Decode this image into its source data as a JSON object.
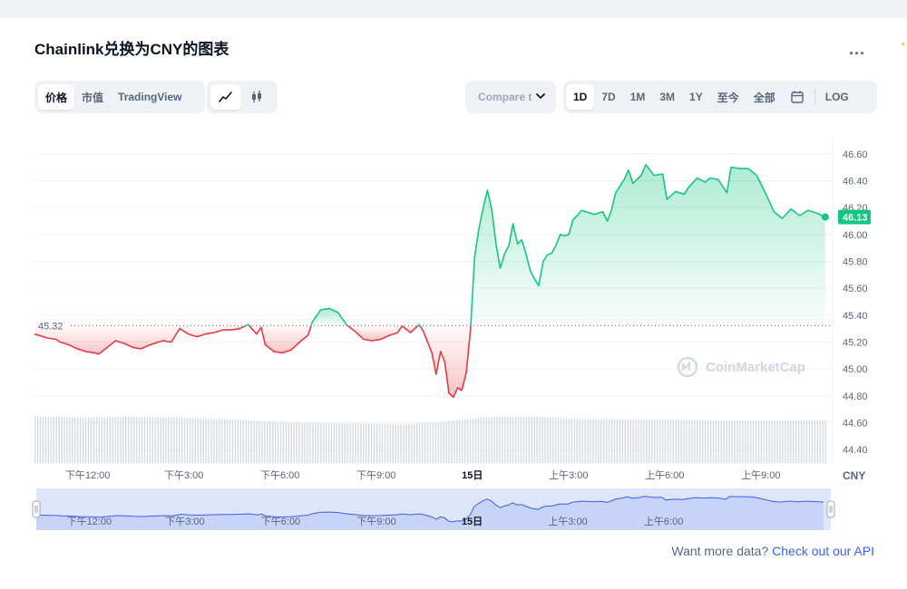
{
  "header": {
    "title": "Chainlink兑换为CNY的图表",
    "more_label": "..."
  },
  "tabs": {
    "price": "价格",
    "market_cap": "市值",
    "tradingview": "TradingView"
  },
  "chart_types": {
    "line_icon": "line-chart-icon",
    "candle_icon": "candlestick-icon"
  },
  "compare": {
    "label": "Compare t"
  },
  "ranges": {
    "d1": "1D",
    "d7": "7D",
    "m1": "1M",
    "m3": "3M",
    "y1": "1Y",
    "ytd": "至今",
    "all": "全部",
    "calendar_icon": "calendar-icon",
    "log": "LOG"
  },
  "colors": {
    "up": "#16c784",
    "down": "#ea3943",
    "accent": "#3861fb",
    "navigator": "#dfe6fb"
  },
  "watermark": "CoinMarketCap",
  "currency": "CNY",
  "footer": {
    "text": "Want more data?",
    "link": "Check out our API"
  },
  "chart_data": {
    "type": "line",
    "baseline": 45.32,
    "baseline_label": "45.32",
    "current_value": 46.13,
    "current_label": "46.13",
    "ylim": [
      44.3,
      46.72
    ],
    "yticks": [
      46.6,
      46.4,
      46.2,
      46.0,
      45.8,
      45.6,
      45.4,
      45.2,
      45.0,
      44.8,
      44.6,
      44.4
    ],
    "ytick_labels": [
      "46.60",
      "46.40",
      "46.20",
      "46.00",
      "45.80",
      "45.60",
      "45.40",
      "45.20",
      "45.00",
      "44.80",
      "44.60",
      "44.40"
    ],
    "xlim": [
      0,
      24.9
    ],
    "xticks": [
      {
        "label": "下午12:00",
        "t": 1.66
      },
      {
        "label": "下午3:00",
        "t": 4.66
      },
      {
        "label": "下午6:00",
        "t": 7.66
      },
      {
        "label": "下午9:00",
        "t": 10.66
      },
      {
        "label": "15日",
        "t": 13.66
      },
      {
        "label": "上午3:00",
        "t": 16.66
      },
      {
        "label": "上午6:00",
        "t": 19.66
      },
      {
        "label": "上午9:00",
        "t": 22.66
      }
    ],
    "navigator_ticks": [
      "下午12:00",
      "下午3:00",
      "下午6:00",
      "下午9:00",
      "15日",
      "上午3:00",
      "上午6:00"
    ],
    "series": [
      {
        "values": [
          [
            0.0,
            45.26
          ],
          [
            0.4,
            45.23
          ],
          [
            0.67,
            45.22
          ],
          [
            0.8,
            45.2
          ],
          [
            1.07,
            45.18
          ],
          [
            1.33,
            45.15
          ],
          [
            1.6,
            45.13
          ],
          [
            1.87,
            45.12
          ],
          [
            2.0,
            45.11
          ],
          [
            2.27,
            45.16
          ],
          [
            2.53,
            45.21
          ],
          [
            2.8,
            45.19
          ],
          [
            3.07,
            45.16
          ],
          [
            3.33,
            45.15
          ],
          [
            3.6,
            45.18
          ],
          [
            3.87,
            45.2
          ],
          [
            4.0,
            45.21
          ],
          [
            4.27,
            45.2
          ],
          [
            4.53,
            45.3
          ],
          [
            4.8,
            45.26
          ],
          [
            5.07,
            45.24
          ],
          [
            5.33,
            45.26
          ],
          [
            5.6,
            45.27
          ],
          [
            5.87,
            45.29
          ],
          [
            6.13,
            45.29
          ],
          [
            6.4,
            45.3
          ],
          [
            6.67,
            45.33
          ],
          [
            6.93,
            45.26
          ],
          [
            7.07,
            45.31
          ],
          [
            7.2,
            45.18
          ],
          [
            7.47,
            45.13
          ],
          [
            7.73,
            45.12
          ],
          [
            8.0,
            45.14
          ],
          [
            8.27,
            45.2
          ],
          [
            8.53,
            45.25
          ],
          [
            8.67,
            45.35
          ],
          [
            8.93,
            45.44
          ],
          [
            9.2,
            45.45
          ],
          [
            9.47,
            45.42
          ],
          [
            9.73,
            45.33
          ],
          [
            10.0,
            45.28
          ],
          [
            10.27,
            45.22
          ],
          [
            10.53,
            45.21
          ],
          [
            10.8,
            45.22
          ],
          [
            11.07,
            45.25
          ],
          [
            11.33,
            45.27
          ],
          [
            11.47,
            45.32
          ],
          [
            11.73,
            45.27
          ],
          [
            12.0,
            45.33
          ],
          [
            12.13,
            45.28
          ],
          [
            12.4,
            45.12
          ],
          [
            12.53,
            44.96
          ],
          [
            12.67,
            45.13
          ],
          [
            12.8,
            45.05
          ],
          [
            12.93,
            44.82
          ],
          [
            13.07,
            44.79
          ],
          [
            13.2,
            44.86
          ],
          [
            13.33,
            44.84
          ],
          [
            13.47,
            44.97
          ],
          [
            13.6,
            45.28
          ],
          [
            13.73,
            45.83
          ],
          [
            13.87,
            46.05
          ],
          [
            14.0,
            46.2
          ],
          [
            14.13,
            46.33
          ],
          [
            14.27,
            46.18
          ],
          [
            14.4,
            45.93
          ],
          [
            14.53,
            45.75
          ],
          [
            14.67,
            45.86
          ],
          [
            14.8,
            45.92
          ],
          [
            14.93,
            46.08
          ],
          [
            15.07,
            45.93
          ],
          [
            15.2,
            45.96
          ],
          [
            15.33,
            45.86
          ],
          [
            15.47,
            45.73
          ],
          [
            15.6,
            45.67
          ],
          [
            15.73,
            45.62
          ],
          [
            15.87,
            45.8
          ],
          [
            16.0,
            45.85
          ],
          [
            16.13,
            45.86
          ],
          [
            16.27,
            45.92
          ],
          [
            16.4,
            46.0
          ],
          [
            16.53,
            45.99
          ],
          [
            16.67,
            46.0
          ],
          [
            16.8,
            46.11
          ],
          [
            16.93,
            46.14
          ],
          [
            17.07,
            46.18
          ],
          [
            17.2,
            46.17
          ],
          [
            17.47,
            46.15
          ],
          [
            17.73,
            46.17
          ],
          [
            17.87,
            46.1
          ],
          [
            18.0,
            46.18
          ],
          [
            18.13,
            46.31
          ],
          [
            18.4,
            46.41
          ],
          [
            18.53,
            46.48
          ],
          [
            18.67,
            46.38
          ],
          [
            18.93,
            46.44
          ],
          [
            19.07,
            46.52
          ],
          [
            19.33,
            46.44
          ],
          [
            19.6,
            46.45
          ],
          [
            19.73,
            46.26
          ],
          [
            20.0,
            46.32
          ],
          [
            20.27,
            46.3
          ],
          [
            20.4,
            46.35
          ],
          [
            20.67,
            46.42
          ],
          [
            20.93,
            46.39
          ],
          [
            21.07,
            46.42
          ],
          [
            21.33,
            46.41
          ],
          [
            21.6,
            46.31
          ],
          [
            21.73,
            46.5
          ],
          [
            22.0,
            46.49
          ],
          [
            22.27,
            46.49
          ],
          [
            22.53,
            46.44
          ],
          [
            22.8,
            46.31
          ],
          [
            23.07,
            46.17
          ],
          [
            23.33,
            46.12
          ],
          [
            23.6,
            46.19
          ],
          [
            23.87,
            46.14
          ],
          [
            24.13,
            46.18
          ],
          [
            24.4,
            46.16
          ],
          [
            24.67,
            46.13
          ]
        ]
      }
    ],
    "volume": [
      [
        0.0,
        0.92
      ],
      [
        1.5,
        0.9
      ],
      [
        3.0,
        0.91
      ],
      [
        4.5,
        0.89
      ],
      [
        6.2,
        0.86
      ],
      [
        7.3,
        0.82
      ],
      [
        8.5,
        0.79
      ],
      [
        10.0,
        0.78
      ],
      [
        11.5,
        0.77
      ],
      [
        12.5,
        0.8
      ],
      [
        13.5,
        0.87
      ],
      [
        14.5,
        0.92
      ],
      [
        15.8,
        0.91
      ],
      [
        17.0,
        0.87
      ],
      [
        18.5,
        0.86
      ],
      [
        20.0,
        0.86
      ],
      [
        21.5,
        0.84
      ],
      [
        23.0,
        0.84
      ],
      [
        24.67,
        0.85
      ]
    ]
  }
}
